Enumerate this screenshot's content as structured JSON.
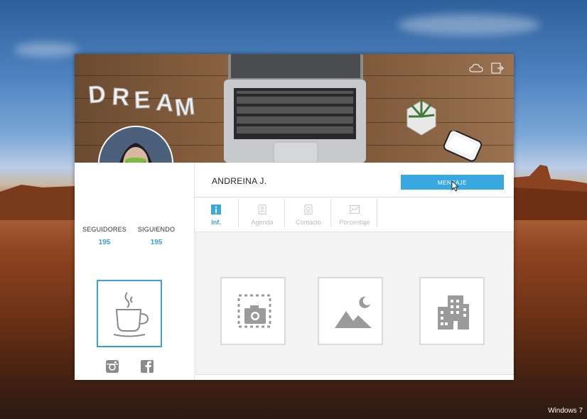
{
  "desktop": {
    "os_label": "Windows 7"
  },
  "banner": {
    "dream_text": "DREAM"
  },
  "profile": {
    "name": "ANDREINA J.",
    "message_button": "MENSAJE",
    "followers_label": "SEGUIDORES",
    "followers_value": "195",
    "following_label": "SIGUIENDO",
    "following_value": "195"
  },
  "tabs": [
    {
      "label": "Inf.",
      "icon": "info-icon",
      "active": true
    },
    {
      "label": "Agenda",
      "icon": "agenda-icon",
      "active": false
    },
    {
      "label": "Contacto",
      "icon": "contact-icon",
      "active": false
    },
    {
      "label": "Porcentaje",
      "icon": "chart-icon",
      "active": false
    }
  ],
  "tiles": [
    {
      "icon": "camera-icon"
    },
    {
      "icon": "image-icon"
    },
    {
      "icon": "building-icon"
    }
  ],
  "colors": {
    "accent": "#39a8e0",
    "icon_gray": "#9a9a9a"
  }
}
